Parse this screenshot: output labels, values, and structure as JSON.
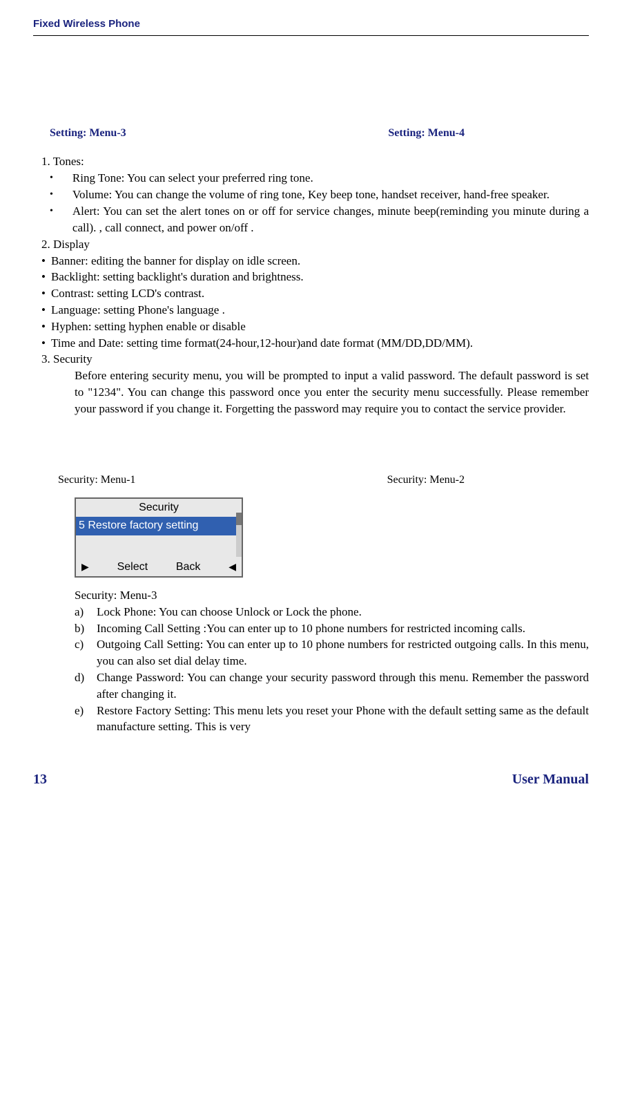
{
  "header": "Fixed Wireless Phone",
  "settingMenu3": "Setting: Menu-3",
  "settingMenu4": "Setting: Menu-4",
  "tones": {
    "num": "1.   Tones:",
    "ring": "Ring  Tone: You can select your preferred ring tone.",
    "volume": "Volume: You can change the volume of ring tone, Key beep tone, handset receiver,  hand-free speaker.",
    "alert": "Alert: You can set the alert tones on or off for service changes, minute beep(reminding you minute during a call). , call connect, and power on/off ."
  },
  "display": {
    "num": "2.   Display",
    "banner": "Banner:  editing the banner for display on idle screen.",
    "backlight": "Backlight: setting  backlight's duration and brightness.",
    "contrast": "Contrast: setting LCD's contrast.",
    "language": "Language: setting Phone's language .",
    "hyphen": "Hyphen: setting hyphen enable or disable",
    "timedate": "Time and Date: setting time format(24-hour,12-hour)and date format (MM/DD,DD/MM)."
  },
  "security": {
    "num": "3.   Security",
    "body": "Before entering security menu, you will be prompted to input a valid password. The default password is set to \"1234\". You can change this password once you enter the security menu successfully. Please remember your password if you change it.  Forgetting the password may require you to contact the service provider."
  },
  "securityMenu1": "Security: Menu-1",
  "securityMenu2": "Security: Menu-2",
  "securityMenu3": "Security: Menu-3",
  "screenshot": {
    "title": "Security",
    "item": "5 Restore factory setting",
    "select": "Select",
    "back": "Back"
  },
  "lettered": {
    "a": "Lock Phone: You can choose Unlock or Lock the phone.",
    "b": "Incoming Call Setting :You can enter up to 10 phone numbers for restricted incoming calls.",
    "c": "Outgoing Call Setting: You can enter up to 10 phone numbers for restricted outgoing calls. In this menu, you can also set dial delay time.",
    "d": "Change Password: You can change your security password through this menu.   Remember the password after changing it.",
    "e": "Restore Factory Setting: This menu lets you reset your Phone with the default setting same as the default manufacture setting. This is very"
  },
  "footer": {
    "page": "13",
    "label": "User Manual"
  }
}
